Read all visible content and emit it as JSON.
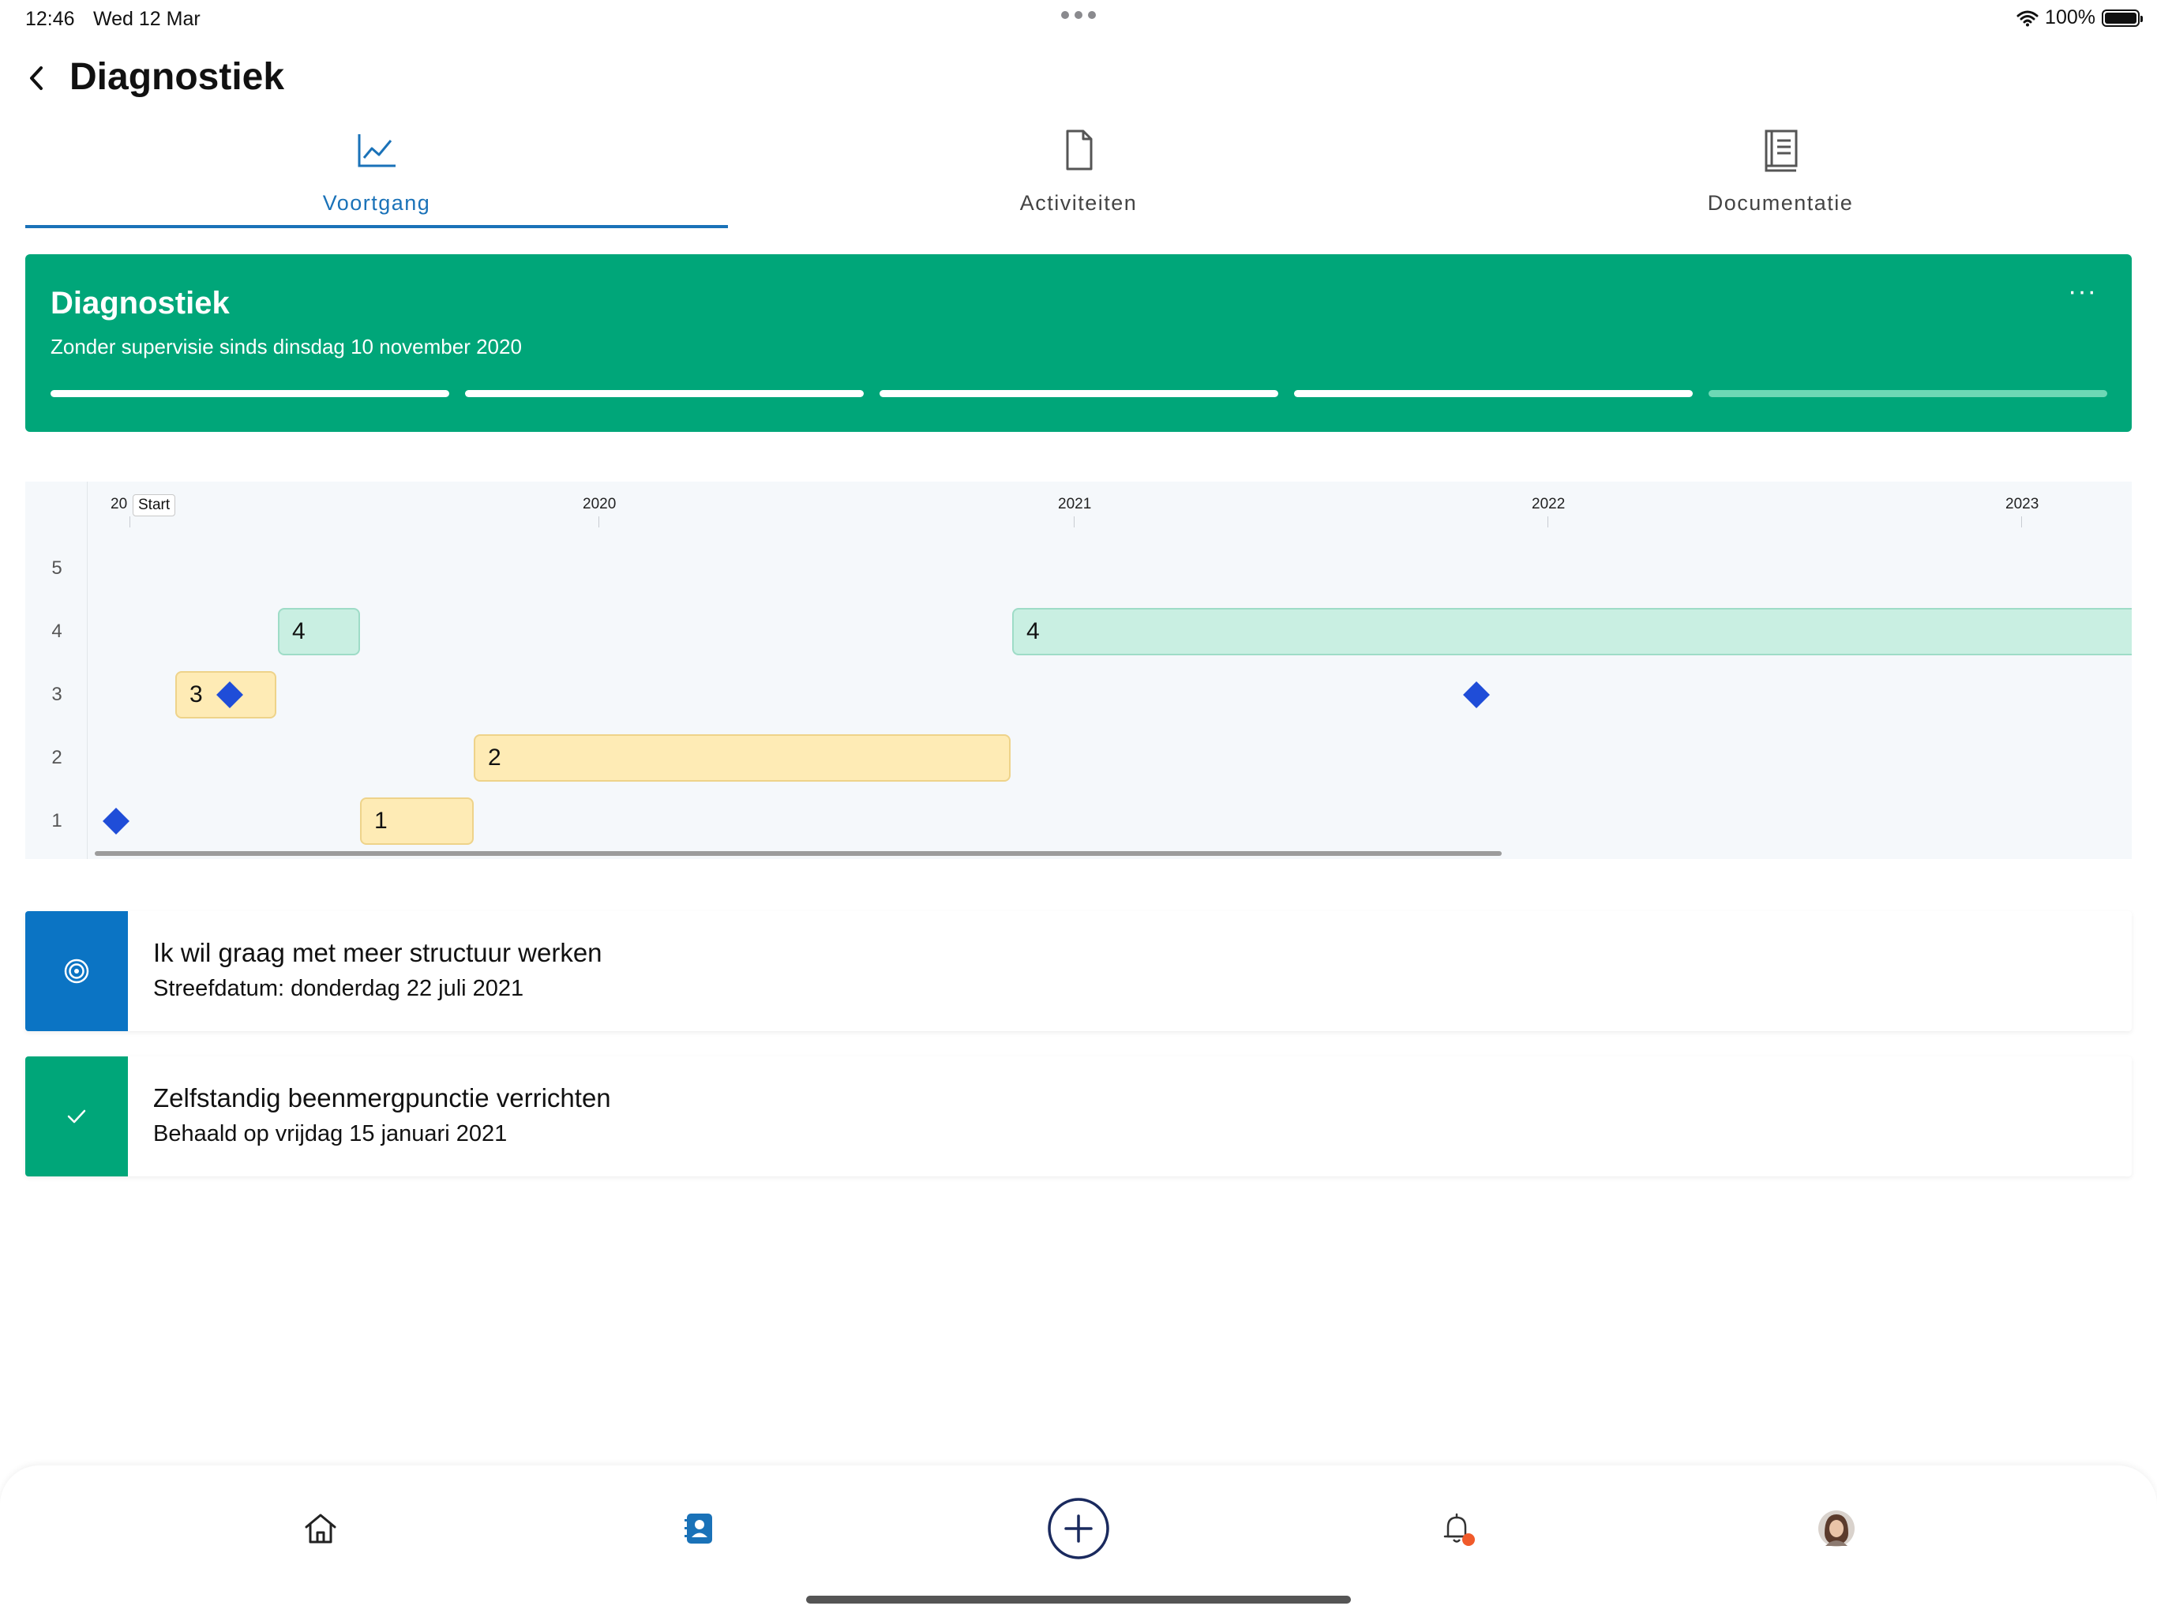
{
  "status_bar": {
    "time": "12:46",
    "date": "Wed 12 Mar",
    "battery": "100%"
  },
  "header": {
    "title": "Diagnostiek",
    "back_icon": "chevron-left-icon"
  },
  "tabs": [
    {
      "label": "Voortgang",
      "icon": "line-chart-icon",
      "active": true
    },
    {
      "label": "Activiteiten",
      "icon": "document-icon",
      "active": false
    },
    {
      "label": "Documentatie",
      "icon": "notebook-icon",
      "active": false
    }
  ],
  "progress_card": {
    "title": "Diagnostiek",
    "subtitle": "Zonder supervisie sinds dinsdag 10 november 2020",
    "more_label": "···",
    "segments_filled": 4,
    "segments_total": 5,
    "color": "#00a679"
  },
  "chart": {
    "y_labels": [
      "5",
      "4",
      "3",
      "2",
      "1"
    ],
    "x_labels": [
      "20",
      "2020",
      "2021",
      "2022",
      "2023"
    ],
    "start_label": "Start",
    "bars": [
      {
        "label": "4",
        "level": 4,
        "color": "green"
      },
      {
        "label": "4",
        "level": 4,
        "color": "green"
      },
      {
        "label": "3",
        "level": 3,
        "color": "yellow"
      },
      {
        "label": "2",
        "level": 2,
        "color": "yellow"
      },
      {
        "label": "1",
        "level": 1,
        "color": "yellow"
      }
    ],
    "diamond_color": "#1f4dd8"
  },
  "goals": [
    {
      "title": "Ik wil graag met meer structuur werken",
      "subtitle": "Streefdatum: donderdag 22 juli 2021",
      "icon": "target-icon",
      "color": "#0b74c4"
    },
    {
      "title": "Zelfstandig beenmergpunctie verrichten",
      "subtitle": "Behaald op vrijdag 15 januari 2021",
      "icon": "check-icon",
      "color": "#00a679"
    }
  ],
  "bottom_nav": [
    {
      "icon": "home-icon"
    },
    {
      "icon": "contacts-icon",
      "active": true
    },
    {
      "icon": "add-circle-icon"
    },
    {
      "icon": "bell-icon",
      "badge": true
    },
    {
      "icon": "avatar"
    }
  ],
  "colors": {
    "accent": "#1a72b8",
    "green": "#00a679",
    "notification": "#f05a2a"
  }
}
